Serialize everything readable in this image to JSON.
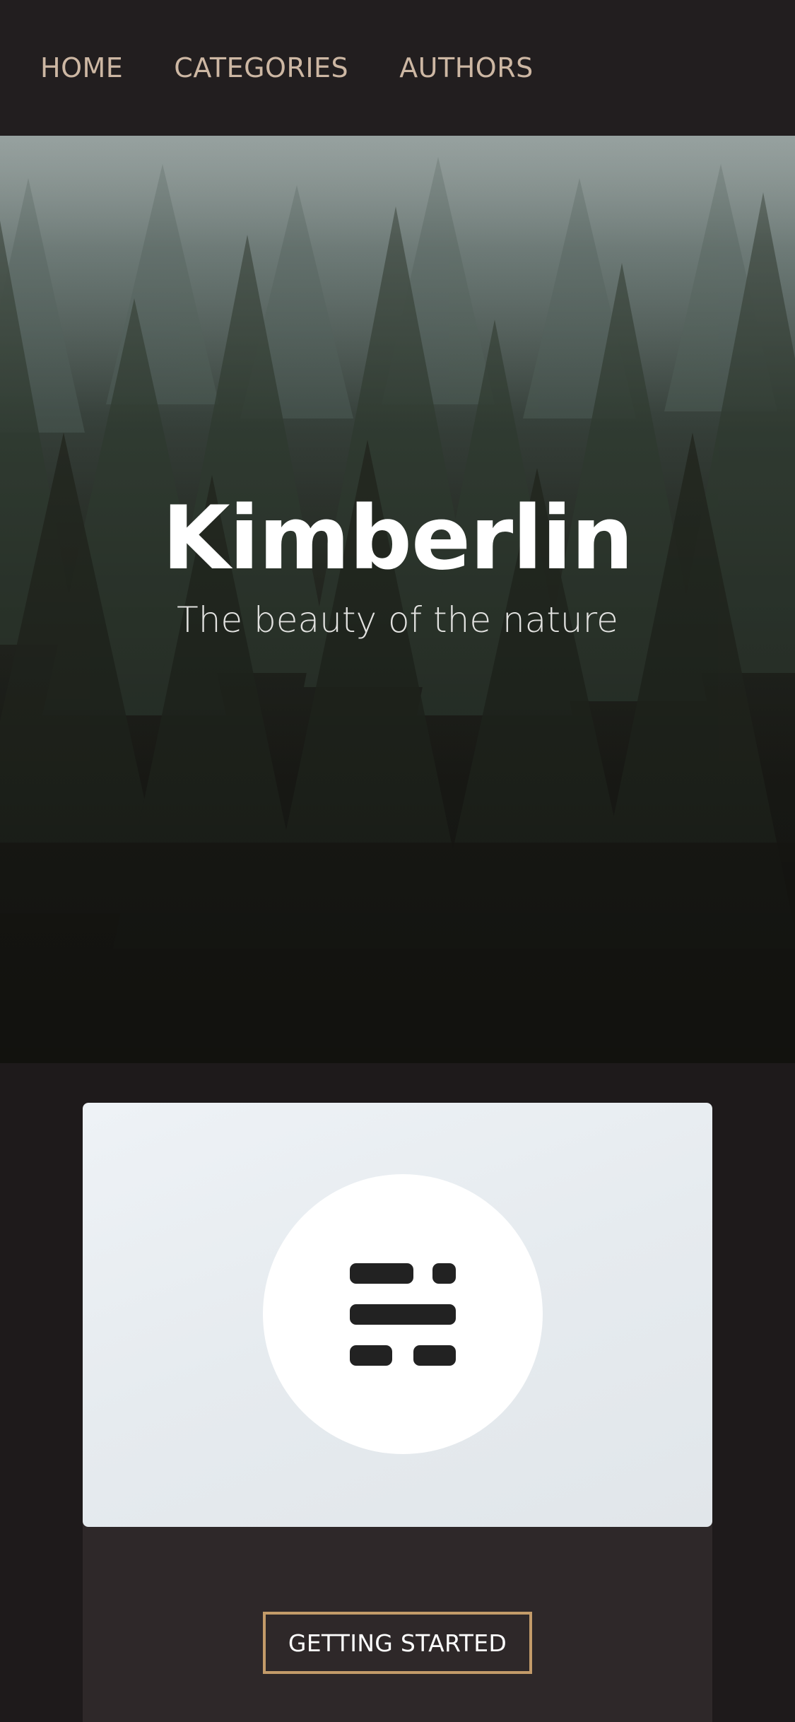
{
  "nav": {
    "items": [
      {
        "label": "HOME"
      },
      {
        "label": "CATEGORIES"
      },
      {
        "label": "AUTHORS"
      }
    ]
  },
  "hero": {
    "title": "Kimberlin",
    "subtitle": "The beauty of the nature"
  },
  "card": {
    "icon": "menu-logo-icon",
    "cta_label": "GETTING STARTED"
  },
  "colors": {
    "background": "#1e1a1b",
    "nav_background": "#221e1f",
    "nav_text": "#cdb7a3",
    "card_background": "#2e2829",
    "accent_border": "#c39b69"
  }
}
